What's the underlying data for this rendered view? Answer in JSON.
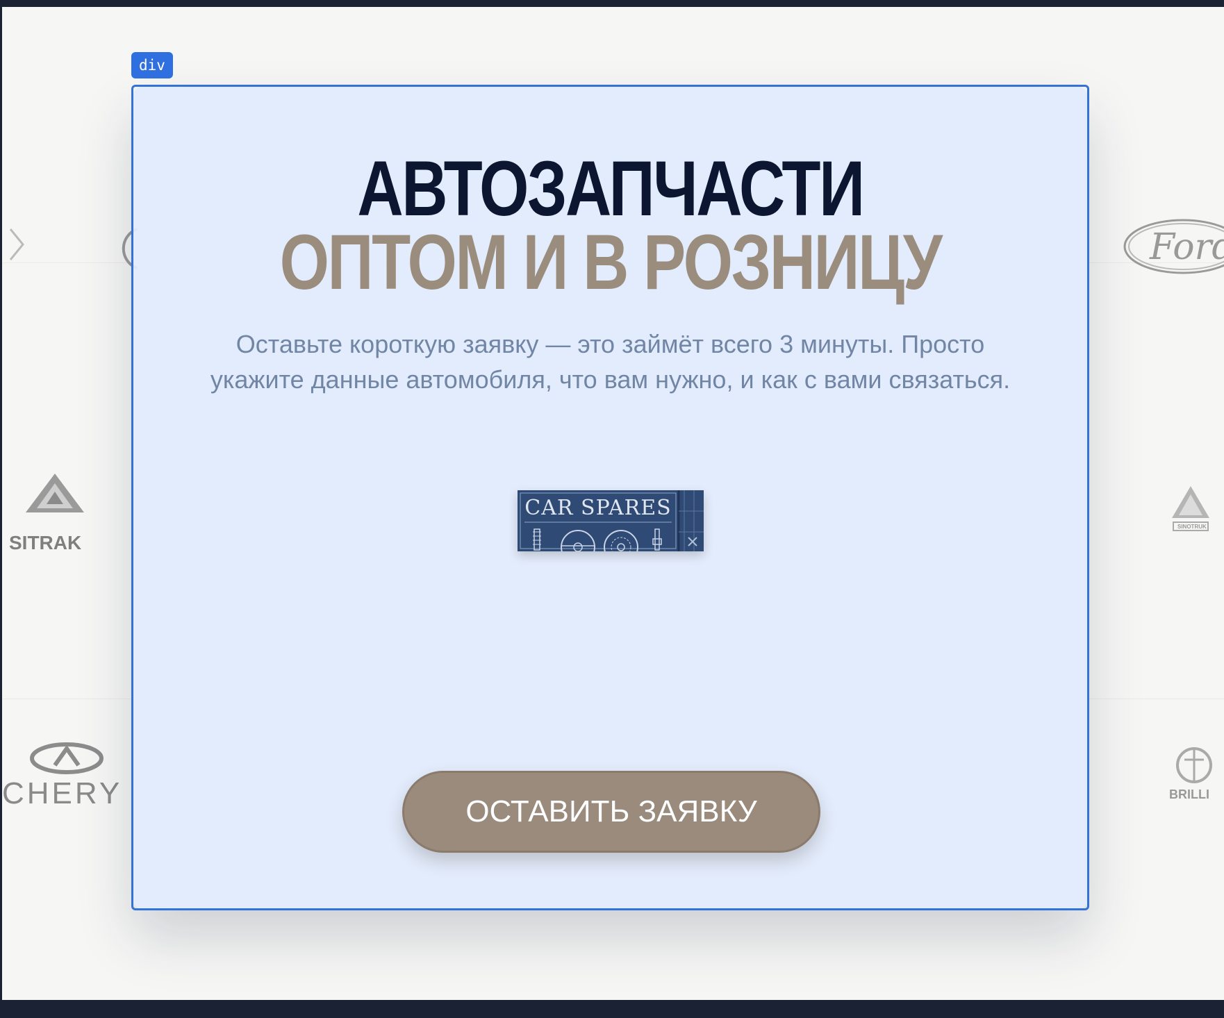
{
  "inspector": {
    "tag_label": "div"
  },
  "hero": {
    "title_line1": "АВТОЗАПЧАСТИ",
    "title_line2": "ОПТОМ И В РОЗНИЦУ",
    "subtitle": "Оставьте короткую заявку — это займёт всего 3 минуты. Просто укажите данные автомобиля, что вам нужно, и как с вами связаться.",
    "banner_title": "CAR SPARES",
    "cta_label": "ОСТАВИТЬ ЗАЯВКУ"
  },
  "brand_logos": {
    "sitrak": "SITRAK",
    "chery": "CHERY",
    "ford": "Ford",
    "sinotruk": "SINOTRUK",
    "brilliance": "BRILLI"
  },
  "colors": {
    "title_dark": "#0c1630",
    "title_beige": "#9b8d7d",
    "subtitle": "#7185a5",
    "cta_bg": "#9a8b7c",
    "highlight": "#3572d6"
  }
}
